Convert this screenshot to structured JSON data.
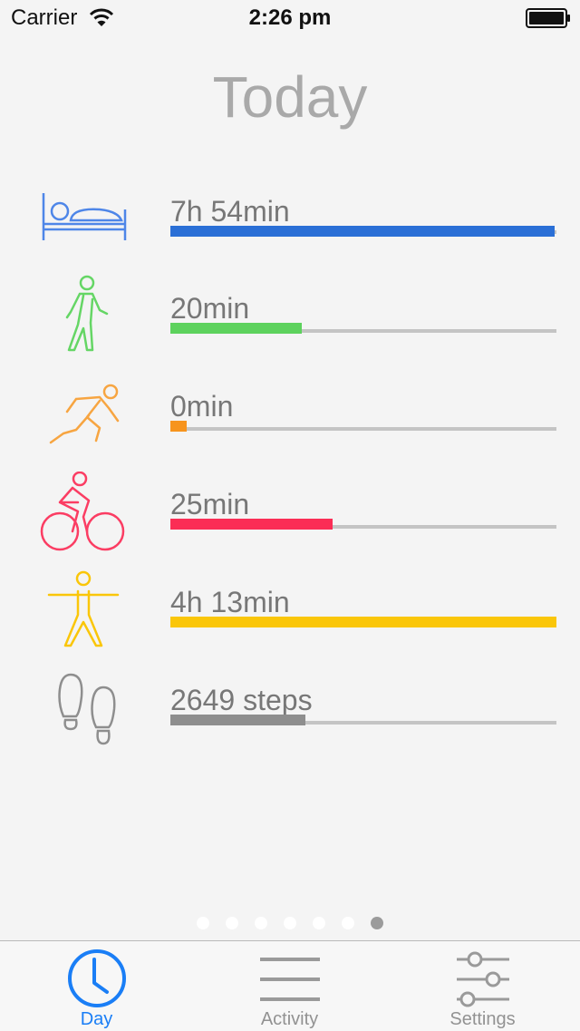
{
  "status_bar": {
    "carrier": "Carrier",
    "time": "2:26 pm"
  },
  "page": {
    "title": "Today"
  },
  "activities": [
    {
      "id": "sleep",
      "icon": "bed-icon",
      "value": "7h 54min",
      "fill_fraction": 0.995,
      "color": "#2a6fd6"
    },
    {
      "id": "walk",
      "icon": "walking-icon",
      "value": "20min",
      "fill_fraction": 0.34,
      "color": "#5dd25d"
    },
    {
      "id": "run",
      "icon": "running-icon",
      "value": "0min",
      "fill_fraction": 0.042,
      "color": "#f7941d"
    },
    {
      "id": "cycle",
      "icon": "cycling-icon",
      "value": "25min",
      "fill_fraction": 0.42,
      "color": "#fb2d55"
    },
    {
      "id": "stand",
      "icon": "standing-icon",
      "value": "4h 13min",
      "fill_fraction": 1.0,
      "color": "#fac609"
    },
    {
      "id": "steps",
      "icon": "footsteps-icon",
      "value": "2649 steps",
      "fill_fraction": 0.35,
      "color": "#8e8e8e"
    }
  ],
  "pager": {
    "count": 7,
    "active_index": 6
  },
  "tab_bar": {
    "tabs": [
      {
        "label": "Day",
        "icon": "clock-icon",
        "active": true
      },
      {
        "label": "Activity",
        "icon": "list-icon",
        "active": false
      },
      {
        "label": "Settings",
        "icon": "sliders-icon",
        "active": false
      }
    ]
  },
  "colors": {
    "accent": "#1a7ef6",
    "track": "#c4c4c4",
    "title": "#a9a9a9"
  }
}
